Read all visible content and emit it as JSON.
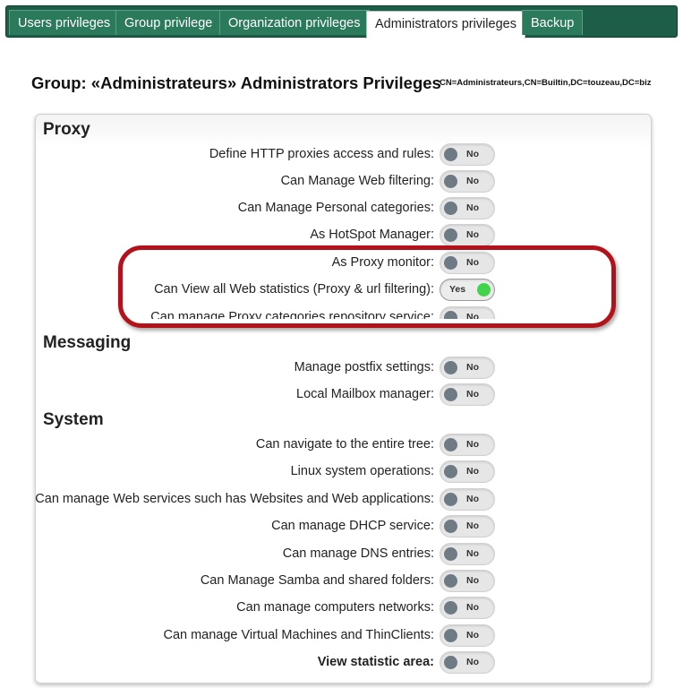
{
  "tabs": [
    {
      "label": "Users privileges",
      "active": false
    },
    {
      "label": "Group privilege",
      "active": false
    },
    {
      "label": "Organization privileges",
      "active": false
    },
    {
      "label": "Administrators privileges",
      "active": true
    },
    {
      "label": "Backup",
      "active": false
    }
  ],
  "page": {
    "title": "Group: «Administrateurs»  Administrators Privileges",
    "dn": "CN=Administrateurs,CN=Builtin,DC=touzeau,DC=biz"
  },
  "sections": {
    "proxy": {
      "title": "Proxy",
      "items": [
        {
          "label": "Define HTTP proxies access and rules:",
          "value": "No"
        },
        {
          "label": "Can Manage Web filtering:",
          "value": "No"
        },
        {
          "label": "Can Manage Personal categories:",
          "value": "No"
        },
        {
          "label": "As HotSpot Manager:",
          "value": "No"
        },
        {
          "label": "As Proxy monitor:",
          "value": "No"
        },
        {
          "label": "Can View all Web statistics (Proxy & url filtering):",
          "value": "Yes"
        },
        {
          "label": "Can manage Proxy categories repository service:",
          "value": "No"
        }
      ]
    },
    "messaging": {
      "title": "Messaging",
      "items": [
        {
          "label": "Manage postfix settings:",
          "value": "No"
        },
        {
          "label": "Local Mailbox manager:",
          "value": "No"
        }
      ]
    },
    "system": {
      "title": "System",
      "items": [
        {
          "label": "Can navigate to the entire tree:",
          "value": "No"
        },
        {
          "label": "Linux system operations:",
          "value": "No"
        },
        {
          "label": "Can manage Web services such has Websites and Web applications:",
          "value": "No"
        },
        {
          "label": "Can manage DHCP service:",
          "value": "No"
        },
        {
          "label": "Can manage DNS entries:",
          "value": "No"
        },
        {
          "label": "Can Manage Samba and shared folders:",
          "value": "No"
        },
        {
          "label": "Can manage computers networks:",
          "value": "No"
        },
        {
          "label": "Can manage Virtual Machines and ThinClients:",
          "value": "No"
        },
        {
          "label": "View statistic area:",
          "value": "No"
        }
      ]
    }
  },
  "colors": {
    "tabbar": "#1c5e47",
    "toggle_on_knob": "#3fd44a",
    "toggle_off_knob": "#6e7a84",
    "highlight": "#b3121b"
  }
}
